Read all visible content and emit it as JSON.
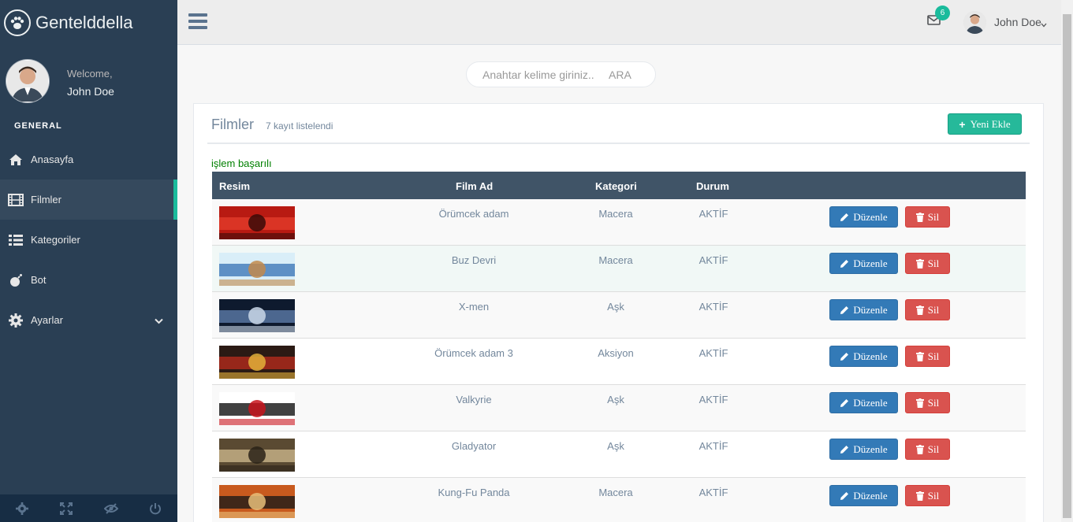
{
  "brand": {
    "title": "Gentelddella"
  },
  "profile": {
    "welcome": "Welcome,",
    "name": "John Doe"
  },
  "sidebar": {
    "section": "GENERAL",
    "items": [
      {
        "label": "Anasayfa",
        "icon": "home-icon"
      },
      {
        "label": "Filmler",
        "icon": "film-icon"
      },
      {
        "label": "Kategoriler",
        "icon": "list-icon"
      },
      {
        "label": "Bot",
        "icon": "bomb-icon"
      },
      {
        "label": "Ayarlar",
        "icon": "gear-icon"
      }
    ]
  },
  "topnav": {
    "mail_count": "6",
    "user_name": "John Doe"
  },
  "search": {
    "placeholder": "Anahtar kelime giriniz..",
    "button": "ARA"
  },
  "panel": {
    "title": "Filmler",
    "subtitle": "7 kayıt listelendi",
    "add_label": "Yeni Ekle",
    "success_message": "işlem başarılı"
  },
  "table": {
    "headers": {
      "image": "Resim",
      "name": "Film Ad",
      "category": "Kategori",
      "status": "Durum"
    },
    "edit_label": "Düzenle",
    "delete_label": "Sil",
    "rows": [
      {
        "name": "Örümcek adam",
        "category": "Macera",
        "status": "AKTİF"
      },
      {
        "name": "Buz Devri",
        "category": "Macera",
        "status": "AKTİF"
      },
      {
        "name": "X-men",
        "category": "Aşk",
        "status": "AKTİF"
      },
      {
        "name": "Örümcek adam 3",
        "category": "Aksiyon",
        "status": "AKTİF"
      },
      {
        "name": "Valkyrie",
        "category": "Aşk",
        "status": "AKTİF"
      },
      {
        "name": "Gladyator",
        "category": "Aşk",
        "status": "AKTİF"
      },
      {
        "name": "Kung-Fu Panda",
        "category": "Macera",
        "status": "AKTİF"
      }
    ]
  },
  "colors": {
    "sidebar": "#2A3F54",
    "accent": "#1ABB9C",
    "primary": "#337AB7",
    "danger": "#D9534F",
    "success": "#26B99A"
  }
}
